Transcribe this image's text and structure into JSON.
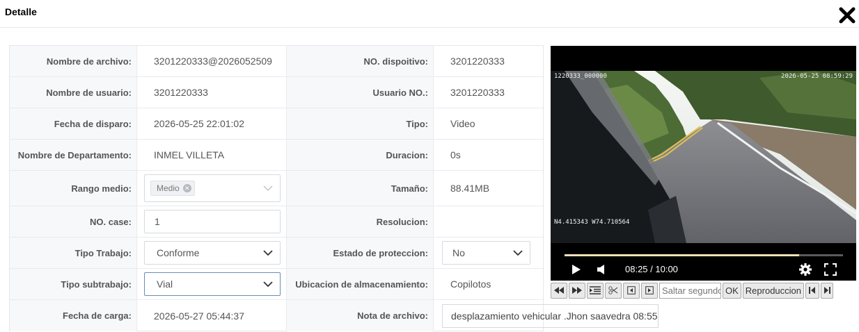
{
  "dialog": {
    "title": "Detalle",
    "close_icon": "close-icon"
  },
  "rows": {
    "r0": {
      "label1": "Nombre de archivo:",
      "value1": "3201220333@2026052509",
      "label2": "NO. dispoitivo:",
      "value2": "3201220333"
    },
    "r1": {
      "label1": "Nombre de usuario:",
      "value1": "3201220333",
      "label2": "Usuario NO.:",
      "value2": "3201220333"
    },
    "r2": {
      "label1": "Fecha de disparo:",
      "value1": "2026-05-25 22:01:02",
      "label2": "Tipo:",
      "value2": "Video"
    },
    "r3": {
      "label1": "Nombre de Departamento:",
      "value1": "INMEL VILLETA",
      "label2": "Duracion:",
      "value2": "0s"
    },
    "r4": {
      "label1": "Rango medio:",
      "tag": "Medio",
      "label2": "Tamaño:",
      "value2": "88.41MB"
    },
    "r5": {
      "label1": "NO. case:",
      "input": "1",
      "label2": "Resolucion:",
      "value2": ""
    },
    "r6": {
      "label1": "Tipo Trabajo:",
      "select": "Conforme",
      "label2": "Estado de proteccion:",
      "select2": "No"
    },
    "r7": {
      "label1": "Tipo subtrabajo:",
      "select": "Vial",
      "label2": "Ubicacion de almacenamiento:",
      "value2": "Copilotos"
    },
    "r8": {
      "label1": "Fecha de carga:",
      "value1": "2026-05-27 05:44:37",
      "label2": "Nota de archivo:",
      "note": "desplazamiento vehicular .Jhon saavedra 08:55"
    }
  },
  "player": {
    "osd_top_left": "1220333_000000",
    "osd_top_right": "2026-05-25  08:59:29",
    "osd_coords": "N4.415343  W74.710564",
    "time": "08:25 / 10:00",
    "progress": 0.842,
    "accent": "#f1e0b8"
  },
  "toolbar": {
    "seek_placeholder": "Saltar segundos",
    "ok": "OK",
    "playback": "Reproduccion"
  }
}
